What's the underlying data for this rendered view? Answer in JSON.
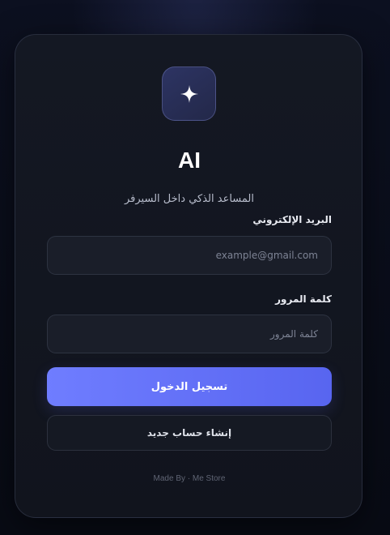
{
  "app": {
    "title": "AI",
    "subtitle": "المساعد الذكي داخل السيرفر",
    "logo_icon": "sparkle-icon"
  },
  "form": {
    "email_label": "البريد الإلكتروني",
    "email_placeholder": "example@gmail.com",
    "email_value": "",
    "password_label": "كلمة المرور",
    "password_placeholder": "كلمة المرور",
    "password_value": "",
    "login_button": "تسجيل الدخول",
    "register_button": "إنشاء حساب جديد"
  },
  "footer": {
    "credit": "Made By · Me Store"
  },
  "colors": {
    "background": "#0a0d18",
    "card": "#141823",
    "accent": "#6f7dff",
    "input_bg": "#1a1e29"
  }
}
